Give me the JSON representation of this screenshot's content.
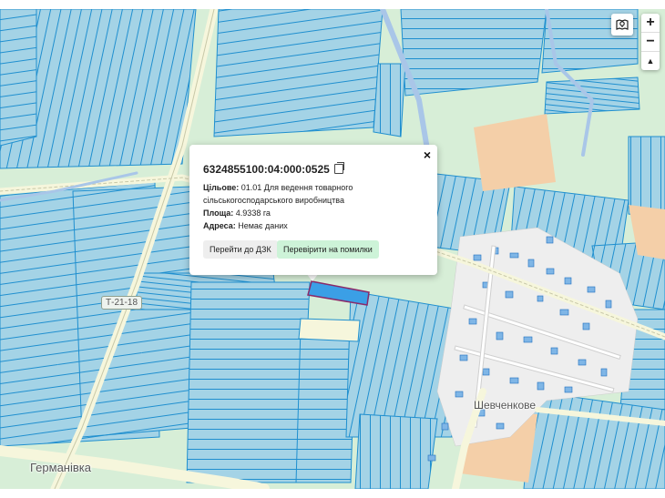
{
  "map": {
    "palette": {
      "parcel_fill": "#a4d3e6",
      "parcel_stroke": "#1f8fcf",
      "selected_fill": "#3b9fe6",
      "selected_stroke": "#8a2a6a",
      "residential": "#f4cfa8",
      "vegetation": "#d7eed7",
      "road": "#f6f6dc",
      "water": "#a9c6e8"
    },
    "labels": {
      "village_germanivka": "Германівка",
      "village_shevchenkove": "Шевченкове",
      "road_code": "Т-21-18"
    }
  },
  "controls": {
    "cadastre_toggle_icon": "map-pin-icon",
    "zoom_in": "+",
    "zoom_out": "−",
    "compass": "▲"
  },
  "popup": {
    "cadastral_number": "6324855100:04:000:0525",
    "close_symbol": "×",
    "copy_icon": "copy-icon",
    "purpose_label": "Цільове:",
    "purpose_value": "01.01 Для ведення товарного сільськогосподарського виробництва",
    "area_label": "Площа:",
    "area_value": "4.9338 га",
    "address_label": "Адреса:",
    "address_value": "Немає даних",
    "button_dzk": "Перейти до ДЗК",
    "button_check": "Перевірити на помилки"
  }
}
